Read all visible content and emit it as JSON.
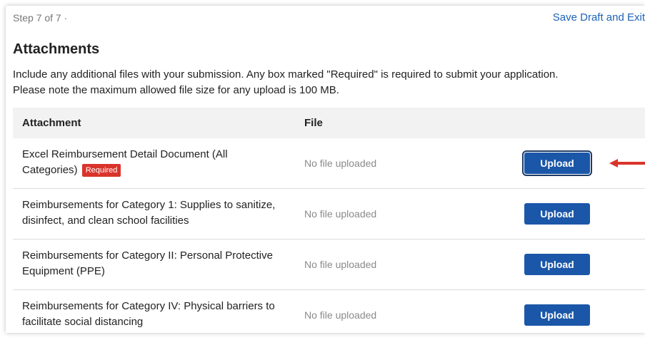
{
  "header": {
    "step": "Step 7 of 7 ·",
    "save_link": "Save Draft and Exit"
  },
  "section": {
    "title": "Attachments",
    "description_line1": "Include any additional files with your submission. Any box marked \"Required\" is required to submit your application.",
    "description_line2": "Please note the maximum allowed file size for any upload is 100 MB."
  },
  "table": {
    "headers": {
      "attachment": "Attachment",
      "file": "File"
    },
    "rows": [
      {
        "name": "Excel Reimbursement Detail Document (All Categories)",
        "badge": "Required",
        "file_status": "No file uploaded",
        "button": "Upload"
      },
      {
        "name": "Reimbursements for Category 1: Supplies to sanitize, disinfect, and clean school facilities",
        "file_status": "No file uploaded",
        "button": "Upload"
      },
      {
        "name": "Reimbursements for Category II: Personal Protective Equipment (PPE)",
        "file_status": "No file uploaded",
        "button": "Upload"
      },
      {
        "name": "Reimbursements for Category IV: Physical barriers to facilitate social distancing",
        "file_status": "No file uploaded",
        "button": "Upload"
      }
    ]
  },
  "colors": {
    "link": "#1c63b7",
    "button": "#1b57a8",
    "required_badge": "#d9342b",
    "arrow": "#d9342b"
  },
  "icons": {
    "annotation_arrow": "left-arrow-icon"
  }
}
